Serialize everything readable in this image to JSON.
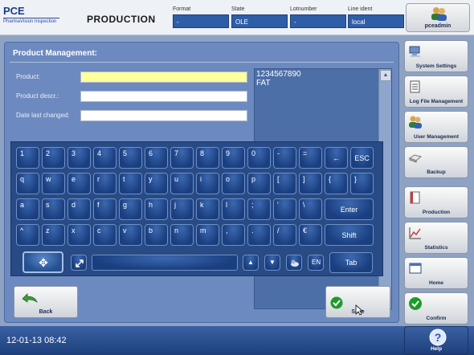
{
  "header": {
    "logo_main": "PCE",
    "logo_sub": "PharmaVision Inspection",
    "title": "PRODUCTION",
    "fields": [
      {
        "label": "Format",
        "value": "-"
      },
      {
        "label": "State",
        "value": "OLE"
      },
      {
        "label": "Lotnumber",
        "value": "-"
      },
      {
        "label": "Line ident",
        "value": "local"
      }
    ],
    "user": "pceadmin"
  },
  "panel": {
    "title": "Product Management:",
    "form": [
      {
        "label": "Product:",
        "value": ""
      },
      {
        "label": "Product descr.:",
        "value": ""
      },
      {
        "label": "Date last changed:",
        "value": ""
      }
    ],
    "list_lines": [
      "1234567890",
      "FAT"
    ]
  },
  "keyboard": {
    "row1": [
      "1",
      "2",
      "3",
      "4",
      "5",
      "6",
      "7",
      "8",
      "9",
      "0",
      "-",
      "=",
      "←"
    ],
    "row1_esc": "ESC",
    "row2": [
      "q",
      "w",
      "e",
      "r",
      "t",
      "y",
      "u",
      "i",
      "o",
      "p",
      "[",
      "]",
      "{",
      "}"
    ],
    "row3": [
      "a",
      "s",
      "d",
      "f",
      "g",
      "h",
      "j",
      "k",
      "l",
      ";",
      "'",
      "\\"
    ],
    "row3_enter": "Enter",
    "row4": [
      "^",
      "z",
      "x",
      "c",
      "v",
      "b",
      "n",
      "m",
      ",",
      ".",
      "/",
      "€"
    ],
    "row4_shift": "Shift",
    "row5": {
      "up": "▲",
      "down": "▼",
      "lang": "EN",
      "tab": "Tab"
    }
  },
  "buttons": {
    "back": "Back",
    "save": "Save"
  },
  "sidebar": [
    {
      "id": "system-settings",
      "label": "System Settings",
      "icon": "computer-icon"
    },
    {
      "id": "log-file-management",
      "label": "Log File Management",
      "icon": "document-icon"
    },
    {
      "id": "user-management",
      "label": "User Management",
      "icon": "users-icon"
    },
    {
      "id": "backup",
      "label": "Backup",
      "icon": "drive-icon"
    },
    {
      "id": "production",
      "label": "Production",
      "icon": "page-icon"
    },
    {
      "id": "statistics",
      "label": "Statistics",
      "icon": "chart-icon"
    },
    {
      "id": "home",
      "label": "Home",
      "icon": "window-icon"
    },
    {
      "id": "confirm",
      "label": "Confirm",
      "icon": "check-icon"
    },
    {
      "id": "help",
      "label": "Help",
      "icon": "help-icon"
    }
  ],
  "status": {
    "datetime": "12-01-13 08:42"
  },
  "colors": {
    "accent": "#2f5ea8",
    "panel": "#6d8ac0",
    "keyboard": "#284a85",
    "confirm_green": "#1c9b2a"
  }
}
